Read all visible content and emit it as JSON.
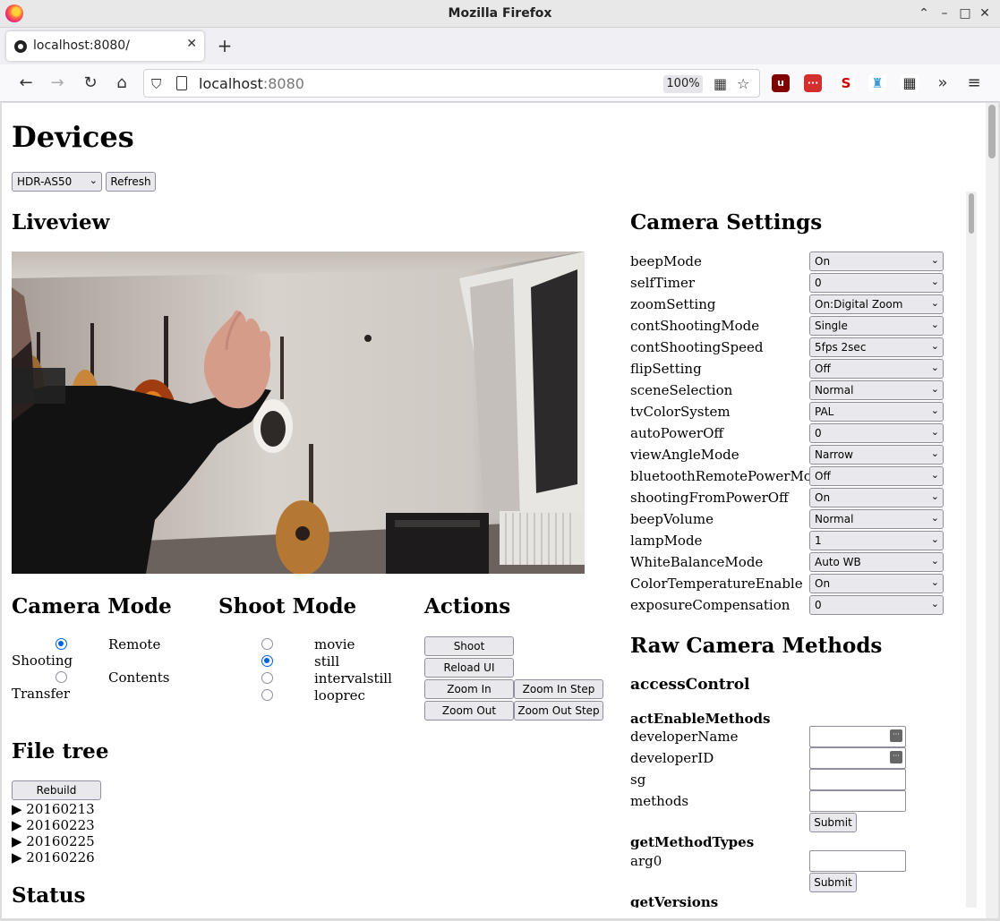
{
  "window": {
    "title": "Mozilla Firefox"
  },
  "tab": {
    "label": "localhost:8080/"
  },
  "urlbar": {
    "host": "localhost",
    "port": ":8080",
    "zoom": "100%"
  },
  "extensions": [
    "ublock-origin",
    "ext-red",
    "ext-s",
    "ext-trophy",
    "ext-grid"
  ],
  "page": {
    "title": "Devices",
    "device_select": "HDR-AS50",
    "refresh_label": "Refresh",
    "liveview_title": "Liveview",
    "camera_mode": {
      "title": "Camera Mode",
      "options": [
        {
          "line1": "Remote",
          "line2": "Shooting",
          "selected": true
        },
        {
          "line1": "Contents",
          "line2": "Transfer",
          "selected": false
        }
      ]
    },
    "shoot_mode": {
      "title": "Shoot Mode",
      "options": [
        {
          "label": "movie",
          "selected": false
        },
        {
          "label": "still",
          "selected": true
        },
        {
          "label": "intervalstill",
          "selected": false
        },
        {
          "label": "looprec",
          "selected": false
        }
      ]
    },
    "actions": {
      "title": "Actions",
      "shoot": "Shoot",
      "reload_ui": "Reload UI",
      "zoom_in": "Zoom In",
      "zoom_in_step": "Zoom In Step",
      "zoom_out": "Zoom Out",
      "zoom_out_step": "Zoom Out Step"
    },
    "file_tree": {
      "title": "File tree",
      "rebuild": "Rebuild",
      "items": [
        "▶ 20160213",
        "▶ 20160223",
        "▶ 20160225",
        "▶ 20160226"
      ]
    },
    "status_title": "Status",
    "camera_settings": {
      "title": "Camera Settings",
      "rows": [
        {
          "name": "beepMode",
          "value": "On"
        },
        {
          "name": "selfTimer",
          "value": "0"
        },
        {
          "name": "zoomSetting",
          "value": "On:Digital Zoom"
        },
        {
          "name": "contShootingMode",
          "value": "Single"
        },
        {
          "name": "contShootingSpeed",
          "value": "5fps 2sec"
        },
        {
          "name": "flipSetting",
          "value": "Off"
        },
        {
          "name": "sceneSelection",
          "value": "Normal"
        },
        {
          "name": "tvColorSystem",
          "value": "PAL"
        },
        {
          "name": "autoPowerOff",
          "value": "0"
        },
        {
          "name": "viewAngleMode",
          "value": "Narrow"
        },
        {
          "name": "bluetoothRemotePowerMode",
          "value": "Off"
        },
        {
          "name": "shootingFromPowerOff",
          "value": "On"
        },
        {
          "name": "beepVolume",
          "value": "Normal"
        },
        {
          "name": "lampMode",
          "value": "1"
        },
        {
          "name": "WhiteBalanceMode",
          "value": "Auto WB"
        },
        {
          "name": "ColorTemperatureEnable",
          "value": "On"
        },
        {
          "name": "exposureCompensation",
          "value": "0"
        }
      ]
    },
    "raw_methods": {
      "title": "Raw Camera Methods",
      "group": "accessControl",
      "act_enable": {
        "title": "actEnableMethods",
        "fields": [
          "developerName",
          "developerID",
          "sg",
          "methods"
        ],
        "submit": "Submit"
      },
      "get_method_types": {
        "title": "getMethodTypes",
        "field": "arg0",
        "submit": "Submit"
      },
      "get_versions": {
        "title": "getVersions"
      }
    }
  }
}
